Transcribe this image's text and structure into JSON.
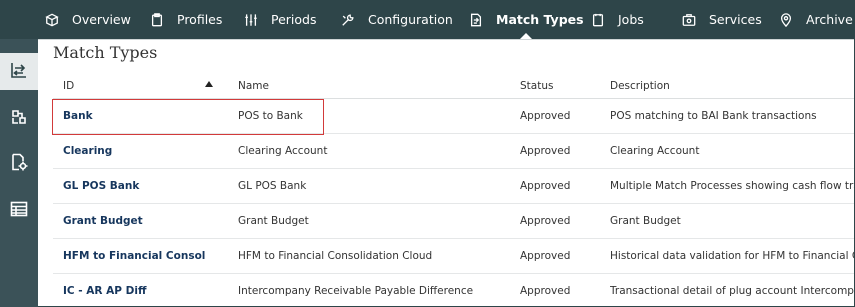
{
  "nav": {
    "tabs": [
      {
        "label": "Overview",
        "icon": "cube-icon"
      },
      {
        "label": "Profiles",
        "icon": "clipboard-icon"
      },
      {
        "label": "Periods",
        "icon": "periods-icon"
      },
      {
        "label": "Configuration",
        "icon": "wrench-icon"
      },
      {
        "label": "Match Types",
        "icon": "match-types-icon",
        "active": true
      },
      {
        "label": "Jobs",
        "icon": "jobs-icon"
      },
      {
        "label": "Services",
        "icon": "services-icon"
      },
      {
        "label": "Archive",
        "icon": "archive-icon"
      }
    ]
  },
  "rail": {
    "items": [
      {
        "icon": "match-types-icon",
        "active": true
      },
      {
        "icon": "rules-icon"
      },
      {
        "icon": "settings-doc-icon"
      },
      {
        "icon": "table-icon"
      }
    ]
  },
  "page": {
    "title": "Match Types"
  },
  "table": {
    "columns": {
      "id": "ID",
      "name": "Name",
      "status": "Status",
      "description": "Description"
    },
    "sort": {
      "column": "ID",
      "direction": "ascending"
    },
    "rows": [
      {
        "id": "Bank",
        "name": "POS to Bank",
        "status": "Approved",
        "description": "POS matching to BAI Bank transactions"
      },
      {
        "id": "Clearing",
        "name": "Clearing Account",
        "status": "Approved",
        "description": "Clearing Account"
      },
      {
        "id": "GL POS Bank",
        "name": "GL POS Bank",
        "status": "Approved",
        "description": "Multiple Match Processes showing cash flow transactio"
      },
      {
        "id": "Grant Budget",
        "name": "Grant Budget",
        "status": "Approved",
        "description": "Grant Budget"
      },
      {
        "id": "HFM to Financial Consol",
        "name": "HFM to Financial Consolidation Cloud",
        "status": "Approved",
        "description": "Historical data validation for HFM to Financial Consolid"
      },
      {
        "id": "IC - AR AP Diff",
        "name": "Intercompany Receivable Payable Difference",
        "status": "Approved",
        "description": "Transactional detail of plug account Intercompany Recei"
      }
    ]
  },
  "colors": {
    "nav_bg": "#2e4549",
    "rail_bg": "#3b5258",
    "id_link": "#16365d",
    "highlight_border": "#d23a3a"
  }
}
